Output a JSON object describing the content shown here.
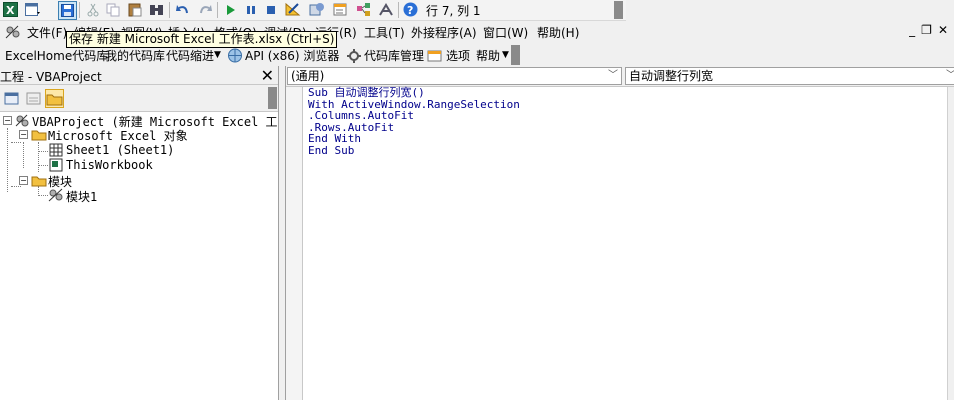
{
  "toolbar": {
    "row_col": "行 7, 列 1",
    "tooltip": "保存 新建 Microsoft Excel 工作表.xlsx (Ctrl+S)"
  },
  "menubar": {
    "items": [
      "文件(F)",
      "编辑(E)",
      "视图(V)",
      "插入(I)",
      "格式(O)",
      "调试(D)",
      "运行(R)",
      "工具(T)",
      "外接程序(A)",
      "窗口(W)",
      "帮助(H)"
    ]
  },
  "toolbar2": {
    "excelhome": "ExcelHome代码库",
    "my_lib": "我的代码库",
    "indent": "代码缩进",
    "api": "API (x86) 浏览器",
    "manager": "代码库管理",
    "options": "选项",
    "help": "帮助"
  },
  "project": {
    "title": "工程 - VBAProject",
    "tree": {
      "root": "VBAProject (新建 Microsoft Excel 工",
      "excel_objects": "Microsoft Excel 对象",
      "sheet1": "Sheet1 (Sheet1)",
      "thisworkbook": "ThisWorkbook",
      "modules": "模块",
      "module1": "模块1"
    }
  },
  "code": {
    "object_combo": "(通用)",
    "proc_combo": "自动调整行列宽",
    "lines": [
      "Sub 自动调整行列宽()",
      "With ActiveWindow.RangeSelection",
      ".Columns.AutoFit",
      ".Rows.AutoFit",
      "End With",
      "End Sub"
    ]
  },
  "colors": {
    "code_text": "#00008b",
    "tooltip_bg": "#ffffe1",
    "excel_green": "#1e7145",
    "save_blue": "#2a6fd6"
  }
}
